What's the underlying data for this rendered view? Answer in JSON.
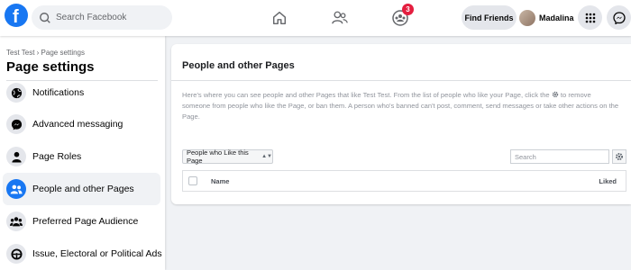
{
  "header": {
    "search_placeholder": "Search Facebook",
    "notification_count": "3",
    "find_friends_label": "Find Friends",
    "profile_name": "Madalina"
  },
  "sidebar": {
    "breadcrumb": "Test Test › Page settings",
    "title": "Page settings",
    "items": [
      {
        "label": "Notifications",
        "icon": "globe-icon"
      },
      {
        "label": "Advanced messaging",
        "icon": "messenger-icon"
      },
      {
        "label": "Page Roles",
        "icon": "person-icon"
      },
      {
        "label": "People and other Pages",
        "icon": "people-icon",
        "active": true
      },
      {
        "label": "Preferred Page Audience",
        "icon": "group-icon"
      },
      {
        "label": "Issue, Electoral or Political Ads",
        "icon": "steering-wheel-icon"
      }
    ]
  },
  "main": {
    "title": "People and other Pages",
    "description_before": "Here's where you can see people and other Pages that like Test Test. From the list of people who like your Page, click the",
    "description_after": "to remove someone from people who like the Page, or ban them. A person who's banned can't post, comment, send messages or take other actions on the Page.",
    "filter_value": "People who Like this Page",
    "search_placeholder": "Search",
    "table": {
      "columns": [
        "Name",
        "Liked"
      ]
    }
  },
  "colors": {
    "brand": "#1877f2",
    "badge": "#e41e3f",
    "background": "#f0f2f5"
  }
}
